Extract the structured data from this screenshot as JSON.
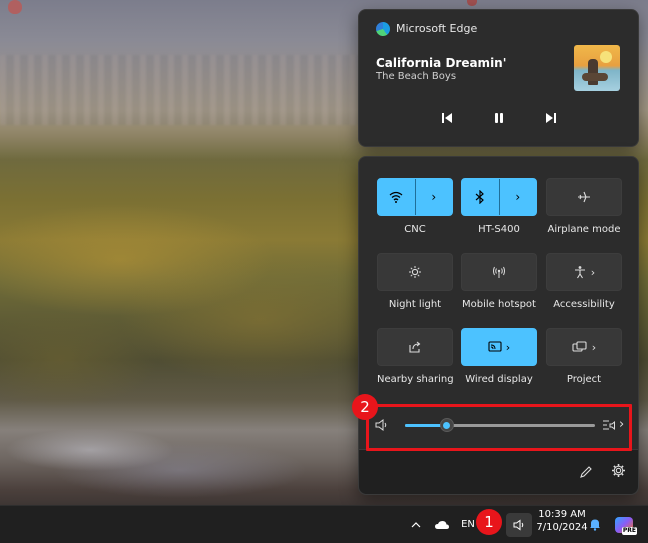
{
  "media": {
    "app_name": "Microsoft Edge",
    "song_title": "California Dreamin'",
    "artist": "The Beach Boys",
    "icons": {
      "app": "edge-icon",
      "previous": "previous-track-icon",
      "pause": "pause-icon",
      "next": "next-track-icon"
    }
  },
  "quick_settings": {
    "tiles": [
      {
        "label": "CNC",
        "icon": "wifi-icon",
        "active": true,
        "expandable": true
      },
      {
        "label": "HT-S400",
        "icon": "bluetooth-icon",
        "active": true,
        "expandable": true
      },
      {
        "label": "Airplane mode",
        "icon": "airplane-icon",
        "active": false,
        "expandable": false
      },
      {
        "label": "Night light",
        "icon": "night-light-icon",
        "active": false,
        "expandable": false
      },
      {
        "label": "Mobile hotspot",
        "icon": "hotspot-icon",
        "active": false,
        "expandable": false
      },
      {
        "label": "Accessibility",
        "icon": "accessibility-icon",
        "active": false,
        "expandable": true
      },
      {
        "label": "Nearby sharing",
        "icon": "share-icon",
        "active": false,
        "expandable": false
      },
      {
        "label": "Wired display",
        "icon": "cast-icon",
        "active": true,
        "expandable": true
      },
      {
        "label": "Project",
        "icon": "project-icon",
        "active": false,
        "expandable": true
      }
    ],
    "volume": {
      "level": 0.22,
      "icon": "speaker-icon",
      "output_icon": "audio-output-icon"
    },
    "footer": {
      "edit_icon": "pencil-icon",
      "settings_icon": "gear-icon"
    }
  },
  "annotations": {
    "badge_1": "1",
    "badge_2": "2",
    "highlight_color": "#e8151b"
  },
  "taskbar": {
    "language": "EN",
    "time": "10:39 AM",
    "date": "7/10/2024",
    "copilot_badge": "PRE"
  },
  "colors": {
    "accent": "#4cc2ff",
    "panel": "#2c2c2c",
    "taskbar": "#202020"
  }
}
